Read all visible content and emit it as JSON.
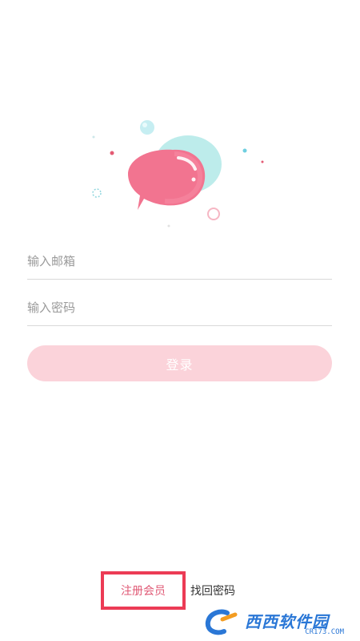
{
  "form": {
    "email_placeholder": "输入邮箱",
    "password_placeholder": "输入密码",
    "login_label": "登录"
  },
  "links": {
    "register_label": "注册会员",
    "forgot_label": "找回密码"
  },
  "watermark": {
    "text": "西西软件园",
    "sub": "CR173.COM"
  },
  "colors": {
    "accent_pink": "#fbd3da",
    "bubble_pink": "#f1718c",
    "bubble_cyan": "#b9ecec",
    "highlight_red": "#ec3b55"
  }
}
